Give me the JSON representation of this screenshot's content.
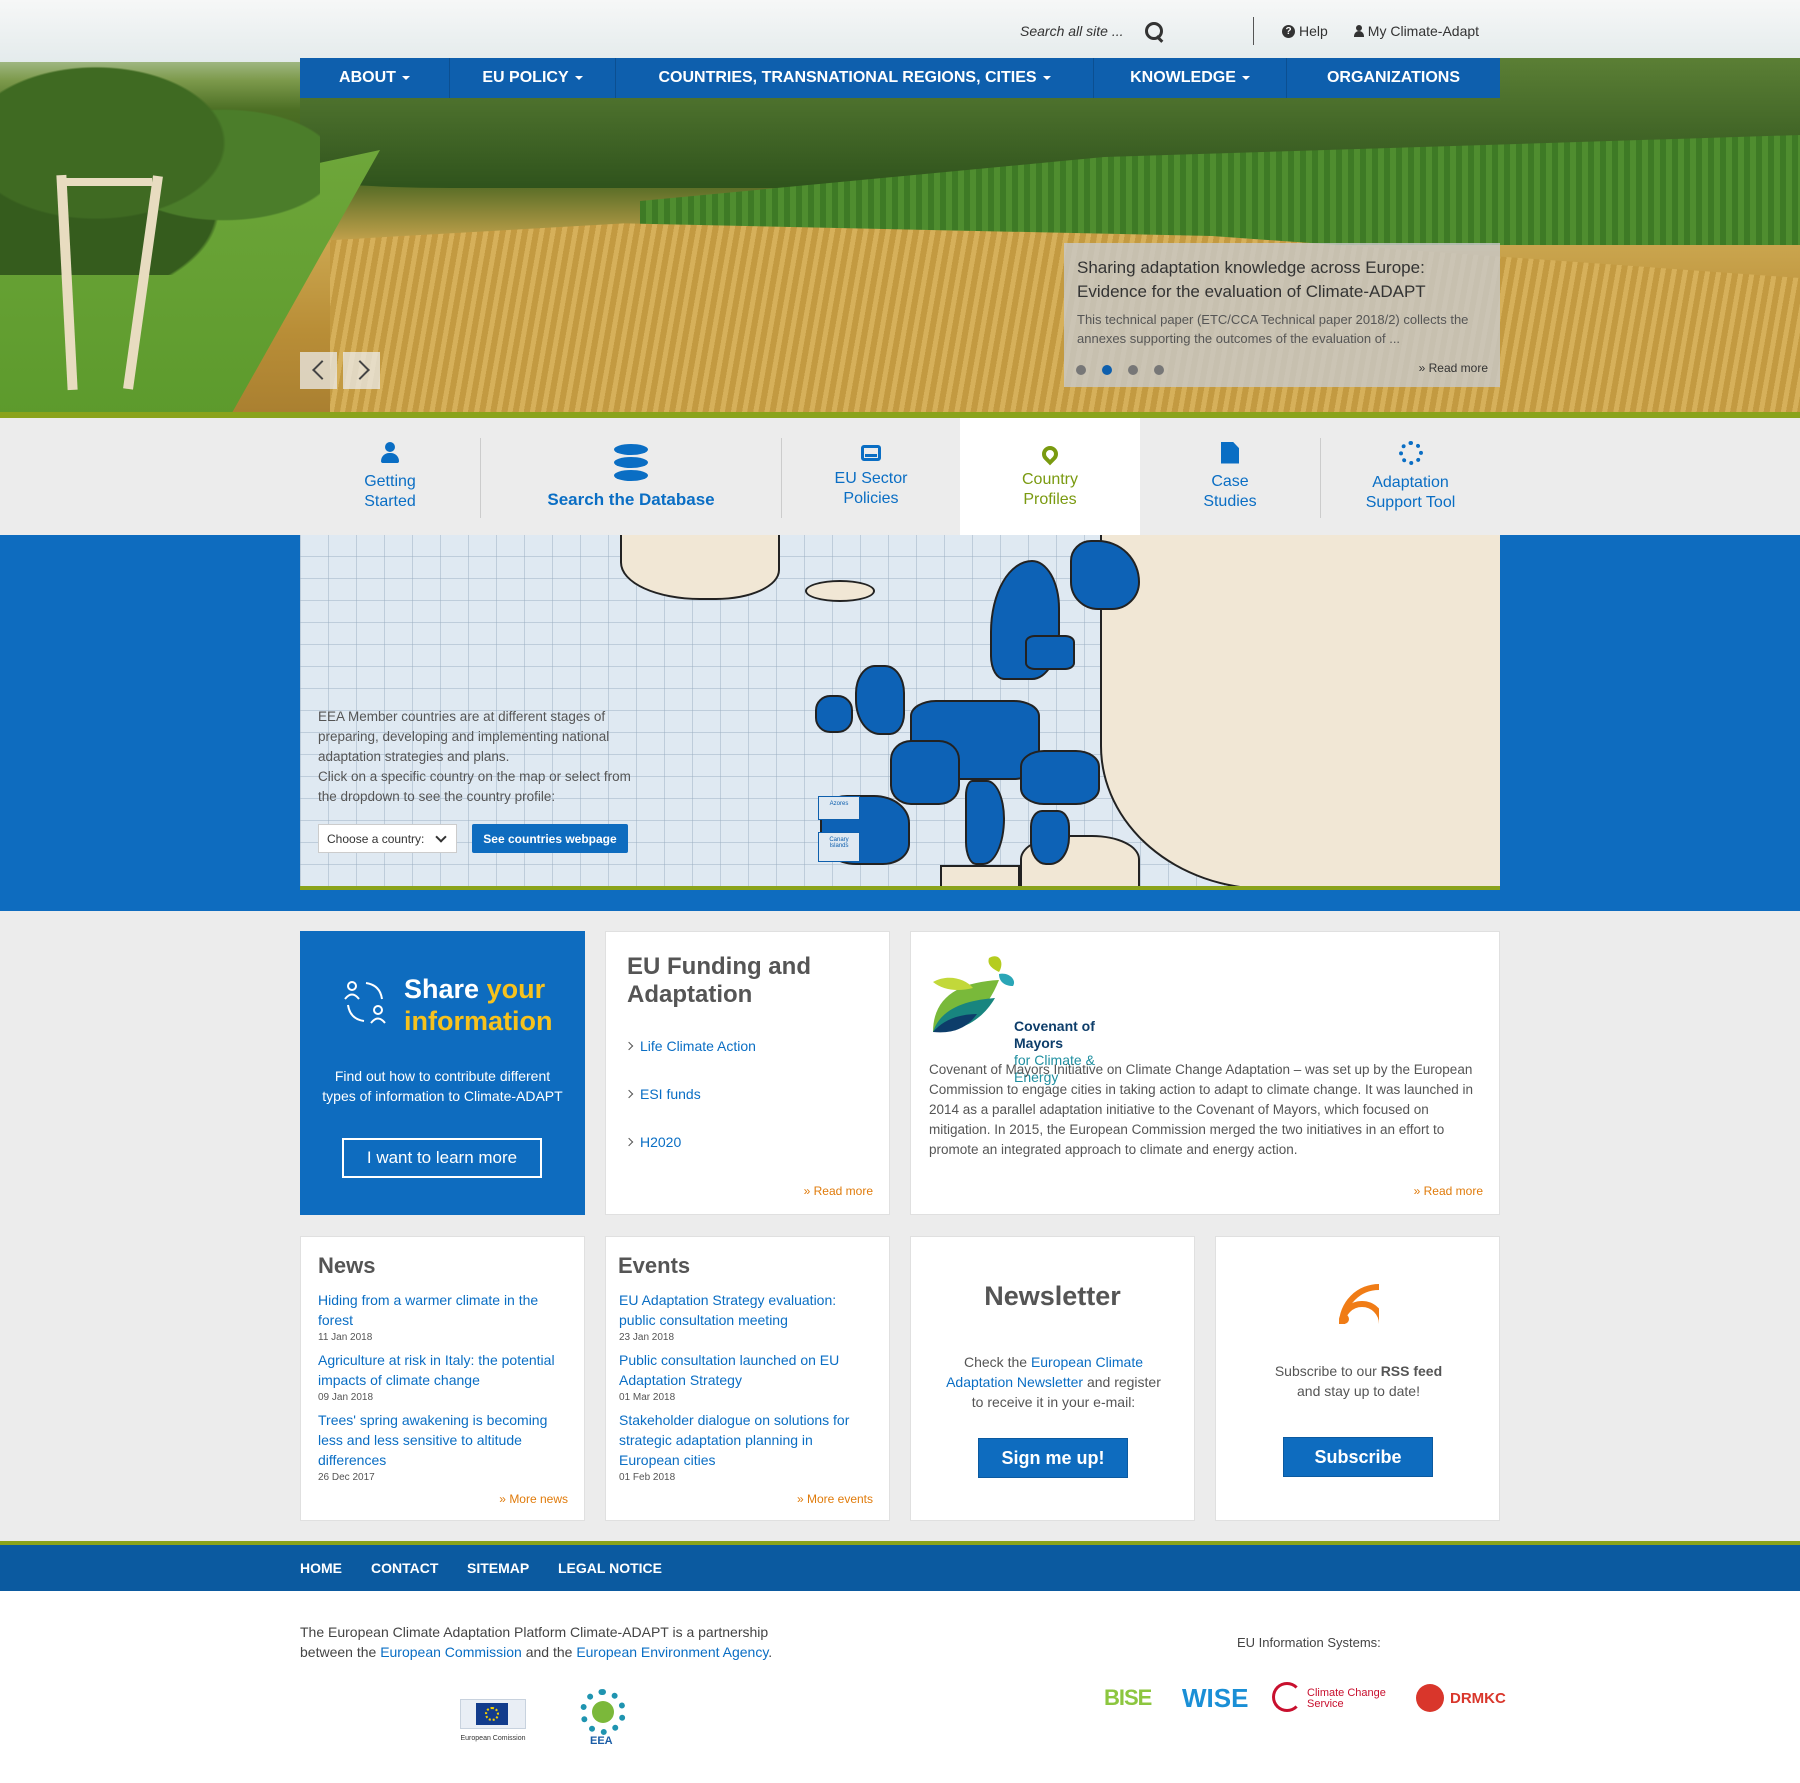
{
  "top_bar": {
    "search_placeholder": "Search all site ...",
    "help_label": "Help",
    "account_label": "My Climate-Adapt"
  },
  "main_nav": {
    "items": [
      {
        "label": "ABOUT",
        "has_dropdown": true
      },
      {
        "label": "EU POLICY",
        "has_dropdown": true
      },
      {
        "label": "COUNTRIES, TRANSNATIONAL REGIONS, CITIES",
        "has_dropdown": true
      },
      {
        "label": "KNOWLEDGE",
        "has_dropdown": true
      },
      {
        "label": "ORGANIZATIONS",
        "has_dropdown": false
      }
    ]
  },
  "hero": {
    "caption_title": "Sharing adaptation knowledge across Europe: Evidence for the evaluation of Climate-ADAPT",
    "caption_text": "This technical paper (ETC/CCA Technical paper 2018/2) collects the annexes supporting the outcomes of the evaluation of ...",
    "read_more": "Read more",
    "slides": 4,
    "active_slide": 2
  },
  "quick_links": [
    {
      "label_1": "Getting",
      "label_2": "Started",
      "icon": "user-icon"
    },
    {
      "label_1": "Search the Database",
      "label_2": "",
      "icon": "database-icon"
    },
    {
      "label_1": "EU Sector",
      "label_2": "Policies",
      "icon": "inbox-icon"
    },
    {
      "label_1": "Country",
      "label_2": "Profiles",
      "icon": "map-marker-icon",
      "active": true
    },
    {
      "label_1": "Case",
      "label_2": "Studies",
      "icon": "file-icon"
    },
    {
      "label_1": "Adaptation",
      "label_2": "Support Tool",
      "icon": "circle-notch-icon"
    }
  ],
  "map_section": {
    "intro_line_1": "EEA Member countries are at different stages of preparing, developing and implementing national adaptation strategies and plans.",
    "intro_line_2": "Click on a specific country on the map or select from the dropdown to see the country profile:",
    "select_value": "Choose a country:",
    "button_label": "See countries webpage",
    "inset_azores": "Azores",
    "inset_canary": "Canary Islands"
  },
  "share": {
    "title_word_1": "Share",
    "title_word_2": "your",
    "title_word_3": "information",
    "text": "Find out how to contribute different types of information to Climate-ADAPT",
    "button_label": "I want to learn more"
  },
  "funding": {
    "title": "EU Funding and Adaptation",
    "links": [
      "Life Climate Action",
      "ESI funds",
      "H2020"
    ],
    "read_more": "Read more"
  },
  "covenant": {
    "logo_line_1": "Covenant of Mayors",
    "logo_line_2": "for Climate & Energy",
    "text": "Covenant of Mayors Initiative on Climate Change Adaptation – was set up by the European Commission to engage cities in taking action to adapt to climate change. It was launched in 2014 as a parallel adaptation initiative to the Covenant of Mayors, which focused on mitigation. In 2015, the European Commission merged the two initiatives in an effort to promote an integrated approach to climate and energy action.",
    "read_more": "Read more"
  },
  "news": {
    "title": "News",
    "items": [
      {
        "title": "Hiding from a warmer climate in the forest",
        "date": "11 Jan 2018"
      },
      {
        "title": "Agriculture at risk in Italy: the potential impacts of climate change",
        "date": "09 Jan 2018"
      },
      {
        "title": "Trees' spring awakening is becoming less and less sensitive to altitude differences",
        "date": "26 Dec 2017"
      }
    ],
    "more": "More news"
  },
  "events": {
    "title": "Events",
    "items": [
      {
        "title": "EU Adaptation  Strategy evaluation: public consultation meeting",
        "date": "23 Jan 2018"
      },
      {
        "title": "Public consultation launched on EU Adaptation Strategy",
        "date": "01 Mar 2018"
      },
      {
        "title": "Stakeholder dialogue on solutions for strategic adaptation planning in European cities",
        "date": "01 Feb 2018"
      }
    ],
    "more": "More events"
  },
  "newsletter": {
    "title": "Newsletter",
    "text_1": "Check the",
    "link": "European Climate Adaptation Newsletter",
    "text_2": "and register to receive it in your e-mail:",
    "button_label": "Sign me up!"
  },
  "rss": {
    "text_1": "Subscribe to our",
    "strong": "RSS feed",
    "text_2": "and stay up to date!",
    "button_label": "Subscribe"
  },
  "footer_nav": [
    "HOME",
    "CONTACT",
    "SITEMAP",
    "LEGAL NOTICE"
  ],
  "footer": {
    "partner_1": "The European Climate Adaptation Platform Climate-ADAPT is a partnership between the",
    "link_ec": "European Commission",
    "partner_and": "and the",
    "link_eea": "European Environment Agency",
    "partner_end": ".",
    "eu_info": "EU Information Systems:",
    "logo_ec_text": "European Comission",
    "logo_eea_text": "EEA",
    "logo_bise": "BISE",
    "logo_wise": "WISE",
    "logo_ccs": "Climate Change Service",
    "logo_drmkc": "DRMKC"
  },
  "colors": {
    "primary_blue": "#0e6cbf",
    "nav_blue": "#0e5fad",
    "accent_green": "#8aa31b",
    "accent_yellow": "#f7c21d",
    "accent_orange": "#e07b0b",
    "link_blue": "#0a6ec4"
  }
}
